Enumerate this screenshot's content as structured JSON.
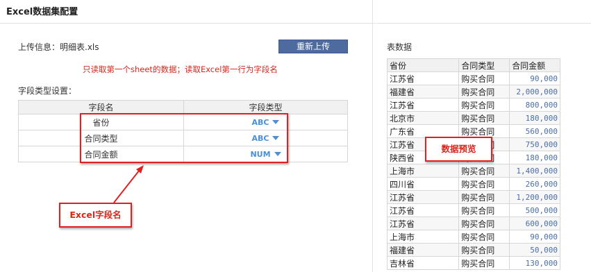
{
  "header": {
    "title": "Excel数据集配置"
  },
  "upload": {
    "label": "上传信息：明细表.xls",
    "reupload_button": "重新上传"
  },
  "notice": "只读取第一个sheet的数据；读取Excel第一行为字段名",
  "field_settings": {
    "label": "字段类型设置：",
    "columns": [
      "字段名",
      "字段类型"
    ],
    "rows": [
      {
        "name": "省份",
        "type": "ABC"
      },
      {
        "name": "合同类型",
        "type": "ABC"
      },
      {
        "name": "合同金额",
        "type": "NUM"
      }
    ]
  },
  "annotations": {
    "excel_field_name": "Excel字段名",
    "data_preview": "数据预览"
  },
  "table_data": {
    "label": "表数据",
    "columns": [
      "省份",
      "合同类型",
      "合同金额"
    ],
    "rows": [
      [
        "江苏省",
        "购买合同",
        "90,000"
      ],
      [
        "福建省",
        "购买合同",
        "2,000,000"
      ],
      [
        "江苏省",
        "购买合同",
        "800,000"
      ],
      [
        "北京市",
        "购买合同",
        "180,000"
      ],
      [
        "广东省",
        "购买合同",
        "560,000"
      ],
      [
        "江苏省",
        "购买合同",
        "750,000"
      ],
      [
        "陕西省",
        "购买合同",
        "180,000"
      ],
      [
        "上海市",
        "购买合同",
        "1,400,000"
      ],
      [
        "四川省",
        "购买合同",
        "260,000"
      ],
      [
        "江苏省",
        "购买合同",
        "1,200,000"
      ],
      [
        "江苏省",
        "购买合同",
        "500,000"
      ],
      [
        "江苏省",
        "购买合同",
        "600,000"
      ],
      [
        "上海市",
        "购买合同",
        "90,000"
      ],
      [
        "福建省",
        "购买合同",
        "50,000"
      ],
      [
        "吉林省",
        "购买合同",
        "130,000"
      ]
    ]
  },
  "colors": {
    "accent_red": "#e02020",
    "button_blue": "#4d6b9f",
    "type_blue": "#4a90d9"
  }
}
